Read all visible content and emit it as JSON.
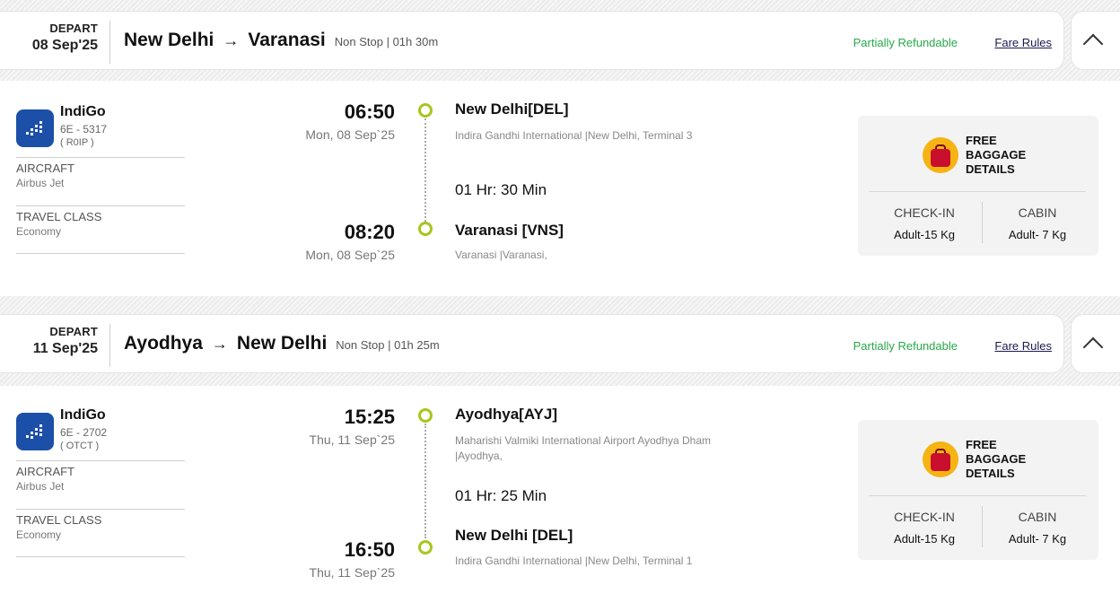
{
  "segments": [
    {
      "depart_label": "DEPART",
      "depart_date": "08 Sep'25",
      "from_city": "New Delhi",
      "to_city": "Varanasi",
      "meta": "Non Stop | 01h 30m",
      "refund_status": "Partially Refundable",
      "fare_rules_label": "Fare Rules",
      "airline": "IndiGo",
      "flight_no": "6E - 5317",
      "fare_code": "( R0IP )",
      "aircraft_label": "AIRCRAFT",
      "aircraft_value": "Airbus Jet",
      "travel_class_label": "TRAVEL CLASS",
      "travel_class_value": "Economy",
      "dep_time": "06:50",
      "dep_date": "Mon, 08 Sep`25",
      "arr_time": "08:20",
      "arr_date": "Mon, 08 Sep`25",
      "dep_place": "New Delhi[DEL]",
      "dep_airport": "Indira Gandhi International |New Delhi, Terminal 3",
      "duration": "01 Hr: 30 Min",
      "arr_place": "Varanasi [VNS]",
      "arr_airport": "Varanasi |Varanasi,",
      "baggage_title": "FREE BAGGAGE DETAILS",
      "checkin_label": "CHECK-IN",
      "checkin_value": "Adult-15 Kg",
      "cabin_label": "CABIN",
      "cabin_value": "Adult- 7 Kg"
    },
    {
      "depart_label": "DEPART",
      "depart_date": "11 Sep'25",
      "from_city": "Ayodhya",
      "to_city": "New Delhi",
      "meta": "Non Stop | 01h 25m",
      "refund_status": "Partially Refundable",
      "fare_rules_label": "Fare Rules",
      "airline": "IndiGo",
      "flight_no": "6E - 2702",
      "fare_code": "( OTCT )",
      "aircraft_label": "AIRCRAFT",
      "aircraft_value": "Airbus Jet",
      "travel_class_label": "TRAVEL CLASS",
      "travel_class_value": "Economy",
      "dep_time": "15:25",
      "dep_date": "Thu, 11 Sep`25",
      "arr_time": "16:50",
      "arr_date": "Thu, 11 Sep`25",
      "dep_place": "Ayodhya[AYJ]",
      "dep_airport": "Maharishi Valmiki International Airport Ayodhya Dham |Ayodhya,",
      "duration": "01 Hr: 25 Min",
      "arr_place": "New Delhi [DEL]",
      "arr_airport": "Indira Gandhi International |New Delhi, Terminal 1",
      "baggage_title": "FREE BAGGAGE DETAILS",
      "checkin_label": "CHECK-IN",
      "checkin_value": "Adult-15 Kg",
      "cabin_label": "CABIN",
      "cabin_value": "Adult- 7 Kg"
    }
  ],
  "colors": {
    "refund_green": "#27a84a",
    "dot_green": "#a9c51e",
    "airline_blue": "#1c4fa8",
    "bag_yellow": "#f5b414",
    "bag_red": "#c8102e"
  },
  "icons": {
    "route_arrow": "→",
    "collapse": "chevron-up-icon",
    "airline_logo": "indigo-logo-icon",
    "baggage": "luggage-icon"
  }
}
